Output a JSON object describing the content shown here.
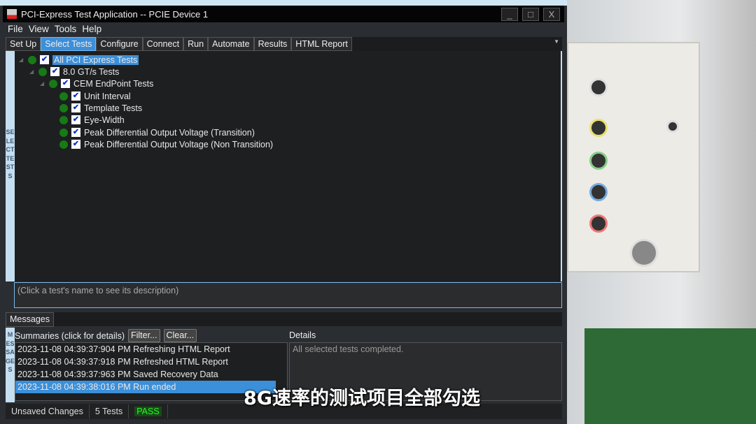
{
  "window": {
    "title": "PCI-Express Test Application -- PCIE Device 1",
    "controls": [
      "_",
      "□",
      "X"
    ]
  },
  "menu": [
    "File",
    "View",
    "Tools",
    "Help"
  ],
  "tabs": [
    {
      "label": "Set Up"
    },
    {
      "label": "Select Tests",
      "active": true
    },
    {
      "label": "Configure"
    },
    {
      "label": "Connect"
    },
    {
      "label": "Run"
    },
    {
      "label": "Automate"
    },
    {
      "label": "Results"
    },
    {
      "label": "HTML Report"
    }
  ],
  "side_label": "SELECT TESTS",
  "tree": [
    {
      "label": "All PCI Express Tests",
      "checked": true,
      "selected": true
    },
    {
      "label": "8.0 GT/s Tests",
      "checked": true
    },
    {
      "label": "CEM EndPoint Tests",
      "checked": true
    },
    {
      "label": "Unit Interval",
      "checked": true
    },
    {
      "label": "Template Tests",
      "checked": true
    },
    {
      "label": "Eye-Width",
      "checked": true
    },
    {
      "label": "Peak Differential Output Voltage (Transition)",
      "checked": true
    },
    {
      "label": "Peak Differential Output Voltage (Non Transition)",
      "checked": true
    }
  ],
  "description_placeholder": "(Click a test's name to see its description)",
  "messages": {
    "tab": "Messages",
    "side_label": "MESSAGES",
    "summaries_label": "Summaries (click for details)",
    "filter": "Filter...",
    "clear": "Clear...",
    "details_label": "Details",
    "rows": [
      "2023-11-08 04:39:37:904 PM Refreshing HTML Report",
      "2023-11-08 04:39:37:918 PM Refreshed HTML Report",
      "2023-11-08 04:39:37:963 PM Saved Recovery Data",
      "2023-11-08 04:39:38:016 PM Run ended"
    ],
    "details_text": "All selected tests completed."
  },
  "status": {
    "changes": "Unsaved Changes",
    "tests": "5 Tests",
    "result": "PASS"
  },
  "subtitle": "8G速率的测试项目全部勾选"
}
